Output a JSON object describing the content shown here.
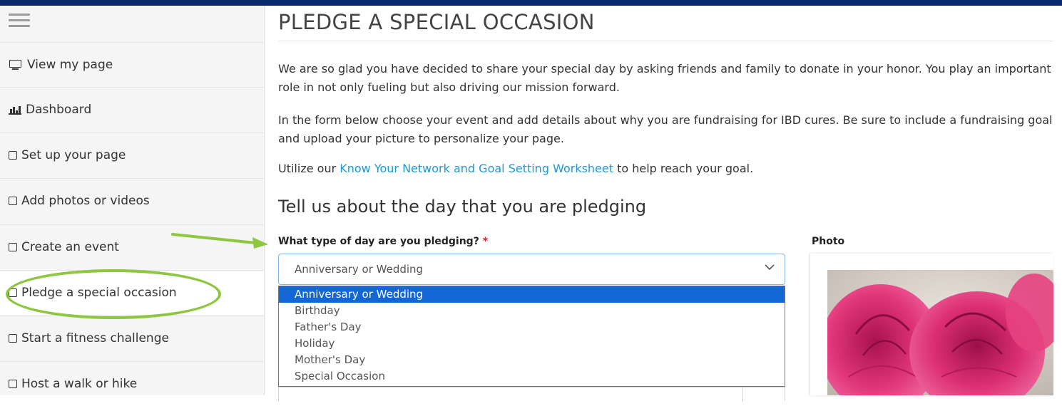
{
  "sidebar": {
    "items": [
      {
        "label": "View my page",
        "icon": "monitor-icon"
      },
      {
        "label": "Dashboard",
        "icon": "bar-chart-icon"
      },
      {
        "label": "Set up your page",
        "icon": "checkbox-icon"
      },
      {
        "label": "Add photos or videos",
        "icon": "checkbox-icon"
      },
      {
        "label": "Create an event",
        "icon": "checkbox-icon"
      },
      {
        "label": "Pledge a special occasion",
        "icon": "checkbox-icon",
        "active": true
      },
      {
        "label": "Start a fitness challenge",
        "icon": "checkbox-icon"
      },
      {
        "label": "Host a walk or hike",
        "icon": "checkbox-icon"
      }
    ]
  },
  "main": {
    "title": "PLEDGE A SPECIAL OCCASION",
    "para1": "We are so glad you have decided to share your special day by asking friends and family to donate in your honor. You play an important role in not only fueling but also driving our mission forward.",
    "para2": "In the form below choose your event and add details about why you are fundraising for IBD cures. Be sure to include a fundraising goal and upload your picture to personalize your page.",
    "para3_before": "Utilize our ",
    "para3_link": "Know Your Network and Goal Setting Worksheet",
    "para3_after": " to help reach your goal.",
    "section_title": "Tell us about the day that you are pledging",
    "field_label": "What type of day are you pledging?",
    "required_mark": "*",
    "select_value": "Anniversary or Wedding",
    "options": [
      "Anniversary or Wedding",
      "Birthday",
      "Father's Day",
      "Holiday",
      "Mother's Day",
      "Special Occasion"
    ],
    "selected_index": 0,
    "photo_label": "Photo"
  },
  "colors": {
    "topbar": "#0b2a6f",
    "link": "#1a9ad6",
    "selected_option": "#1266d6",
    "annotation": "#8dc63f",
    "required": "#d0282e"
  }
}
